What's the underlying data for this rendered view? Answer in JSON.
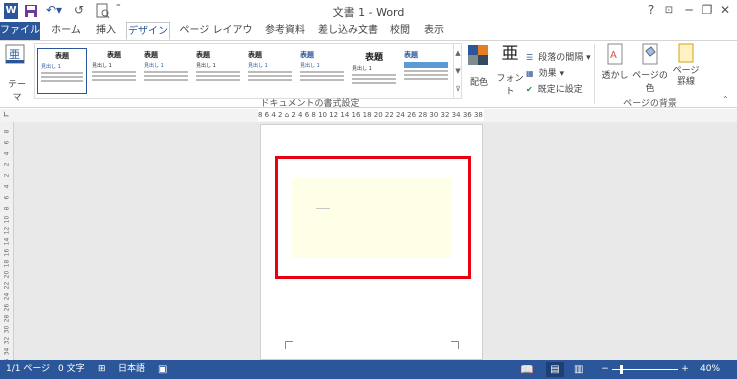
{
  "window": {
    "title": "文書 1 - Word",
    "help": "?",
    "minimize": "─",
    "restore": "❐",
    "close": "✕"
  },
  "qat": {
    "word_icon": "W",
    "undo_arrow": "⇦",
    "redo_arrow": "↺"
  },
  "tabs": [
    "ファイル",
    "ホーム",
    "挿入",
    "デザイン",
    "ページ レイアウト",
    "参考資料",
    "差し込み文書",
    "校閲",
    "表示"
  ],
  "ribbon": {
    "themes_label": "テーマ",
    "style_thumbs": [
      {
        "head": "表題",
        "sub": "見出し 1"
      },
      {
        "head": "表題",
        "sub": "見出し 1"
      },
      {
        "head": "表題",
        "sub": "見出し 1"
      },
      {
        "head": "表題",
        "sub": "見出し 1"
      },
      {
        "head": "表題",
        "sub": "見出し 1"
      },
      {
        "head": "表題",
        "sub": "見出し 1"
      },
      {
        "head": "表題",
        "sub": "見出し 1"
      },
      {
        "head": "表題",
        "sub": "見出し 1"
      }
    ],
    "colors_label": "配色",
    "fonts_label": "フォント",
    "fonts_glyph": "亜",
    "paragraph_spacing": "段落の間隔 ▾",
    "effects": "効果 ▾",
    "set_default": "既定に設定",
    "group_doc_format": "ドキュメントの書式設定",
    "watermark": "透かし",
    "page_color": "ページの色",
    "page_borders_1": "ページ",
    "page_borders_2": "罫線",
    "group_page_bg": "ページの背景"
  },
  "ruler": {
    "horizontal": "8 6 4 2 ⌂ 2 4 6 8 10 12 14 16 18 20 22 24 26 28 30 32 34 36 38 △42 44 46 48",
    "vertical": [
      "8",
      "6",
      "4",
      "2",
      "2",
      "4",
      "6",
      "8",
      "10",
      "12",
      "14",
      "16",
      "18",
      "20",
      "22",
      "24",
      "26",
      "28",
      "30",
      "32",
      "34",
      "36",
      "38"
    ]
  },
  "status": {
    "pages": "1/1 ページ",
    "words": "0 文字",
    "language": "日本語",
    "zoom": "40%",
    "minus": "−",
    "plus": "+"
  },
  "colors": {
    "accent": "#2b579a",
    "highlight": "#e60012",
    "note_fill": "#fffee6"
  }
}
